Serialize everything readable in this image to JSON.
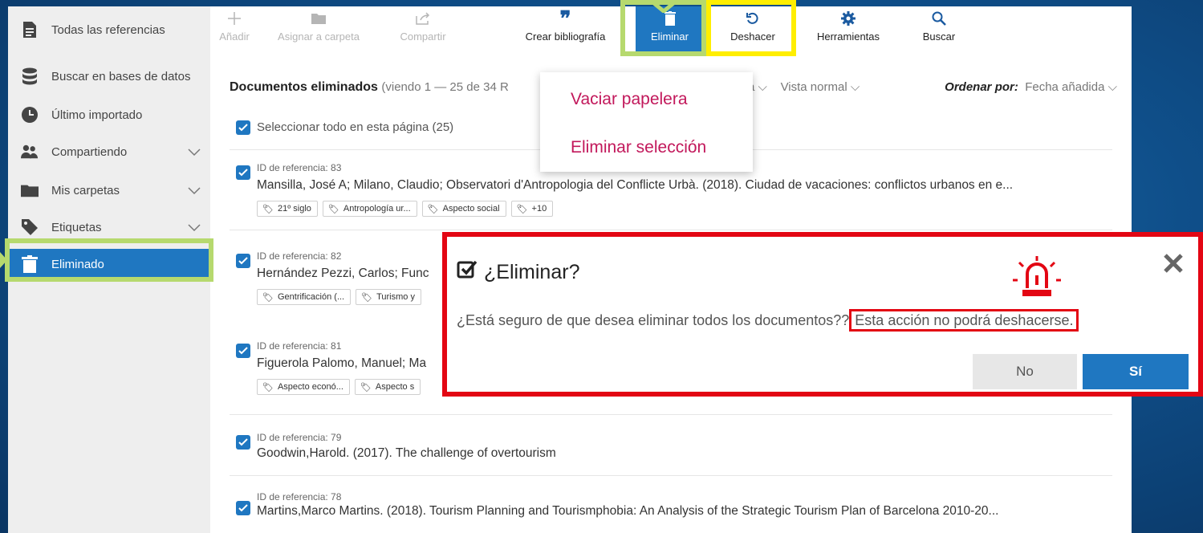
{
  "toolbar": {
    "add": "Añadir",
    "assign_folder": "Asignar a carpeta",
    "share": "Compartir",
    "create_bibliography": "Crear bibliografía",
    "delete": "Eliminar",
    "undo": "Deshacer",
    "tools": "Herramientas",
    "search": "Buscar"
  },
  "sidebar": {
    "items": [
      {
        "label": "Todas las referencias",
        "icon": "document-icon"
      },
      {
        "label": "Buscar en bases de datos",
        "icon": "database-icon"
      },
      {
        "label": "Último importado",
        "icon": "clock-icon"
      },
      {
        "label": "Compartiendo",
        "icon": "people-icon"
      },
      {
        "label": "Mis carpetas",
        "icon": "folder-icon"
      },
      {
        "label": "Etiquetas",
        "icon": "tag-icon"
      },
      {
        "label": "Eliminado",
        "icon": "trash-icon"
      }
    ]
  },
  "header": {
    "title": "Documentos eliminados",
    "subtitle": "(viendo 1 — 25 de 34 R",
    "view_left": "a",
    "view_mode": "Vista normal",
    "sort_label": "Ordenar por:",
    "sort_value": "Fecha añadida"
  },
  "select_all": "Seleccionar todo en esta página (25)",
  "dropdown": {
    "empty_trash": "Vaciar papelera",
    "delete_selection": "Eliminar selección"
  },
  "references": [
    {
      "id": "ID de referencia: 83",
      "text": "Mansilla, José A; Milano, Claudio; Observatori d'Antropologia del Conflicte Urbà. (2018). Ciudad de vacaciones: conflictos urbanos en e...",
      "tags": [
        "21º siglo",
        "Antropología ur...",
        "Aspecto social",
        "+10"
      ]
    },
    {
      "id": "ID de referencia: 82",
      "text": "Hernández Pezzi, Carlos; Func",
      "tags": [
        "Gentrificación (...",
        "Turismo y"
      ]
    },
    {
      "id": "ID de referencia: 81",
      "text": "Figuerola Palomo, Manuel; Ma",
      "tags": [
        "Aspecto econó...",
        "Aspecto s"
      ]
    },
    {
      "id": "ID de referencia: 79",
      "text": "Goodwin,Harold. (2017). The challenge of overtourism",
      "tags": []
    },
    {
      "id": "ID de referencia: 78",
      "text": "Martins,Marco Martins. (2018). Tourism Planning and Tourismphobia: An Analysis of the Strategic Tourism Plan of Barcelona 2010-20...",
      "tags": []
    }
  ],
  "modal": {
    "title": "¿Eliminar?",
    "body": "¿Está seguro de que desea eliminar todos los documentos??",
    "warning": "Esta acción no podrá deshacerse.",
    "no": "No",
    "yes": "Sí"
  },
  "colors": {
    "accent": "#1f77c1",
    "highlight_green": "#b6d96e",
    "highlight_yellow": "#ffee00",
    "alert_red": "#e30613",
    "dropdown_text": "#c2185b"
  }
}
